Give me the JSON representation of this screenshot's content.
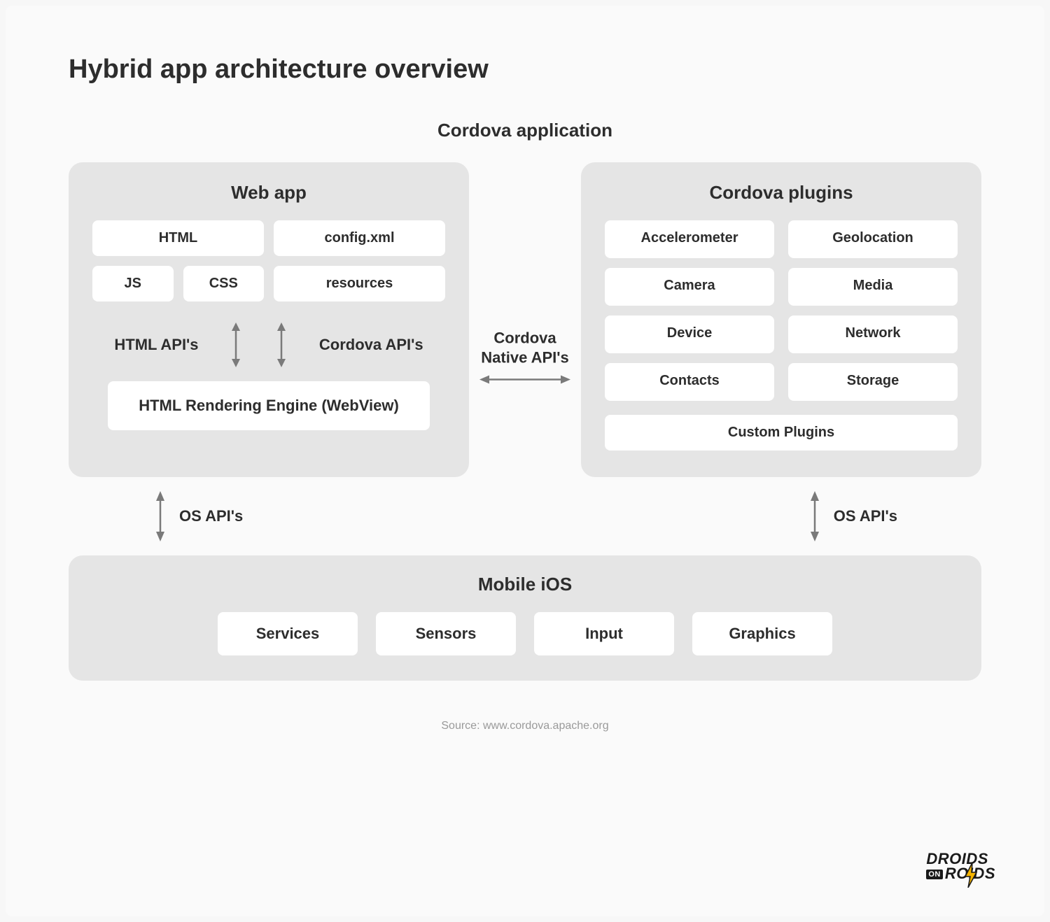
{
  "title": "Hybrid app architecture overview",
  "subtitle": "Cordova application",
  "webapp": {
    "title": "Web app",
    "items": {
      "html": "HTML",
      "config": "config.xml",
      "js": "JS",
      "css": "CSS",
      "resources": "resources"
    },
    "api_left": "HTML API's",
    "api_right": "Cordova API's",
    "render": "HTML Rendering Engine (WebView)"
  },
  "plugins": {
    "title": "Cordova plugins",
    "items": [
      "Accelerometer",
      "Geolocation",
      "Camera",
      "Media",
      "Device",
      "Network",
      "Contacts",
      "Storage"
    ],
    "custom": "Custom Plugins"
  },
  "middle": {
    "label": "Cordova Native API's"
  },
  "os_api_label": "OS API's",
  "mobile": {
    "title": "Mobile iOS",
    "items": [
      "Services",
      "Sensors",
      "Input",
      "Graphics"
    ]
  },
  "source": "Source: www.cordova.apache.org",
  "logo": {
    "line1": "DROIDS",
    "on": "ON",
    "line2": "ROIDS"
  }
}
